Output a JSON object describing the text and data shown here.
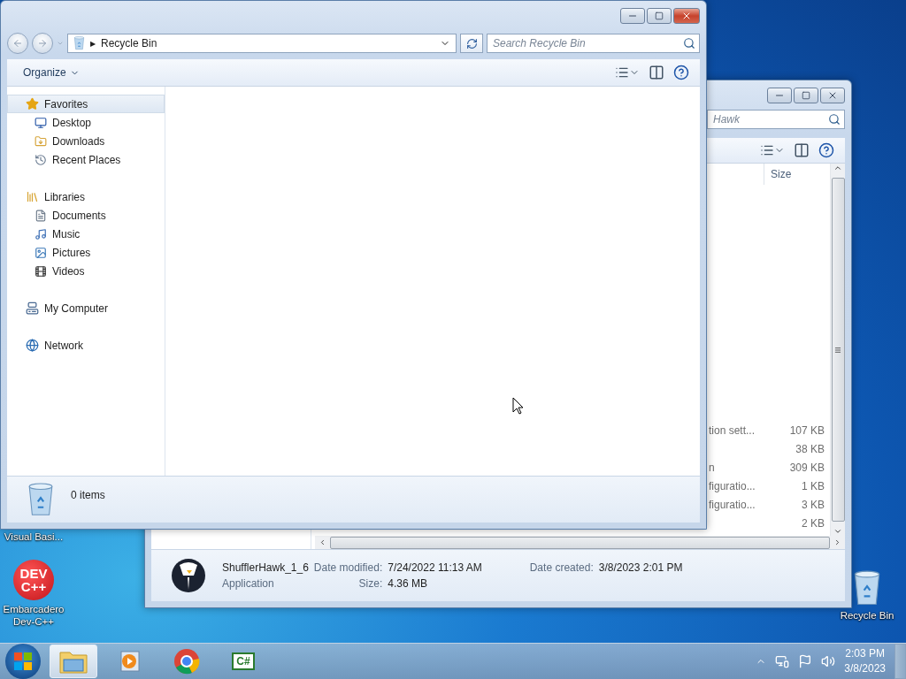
{
  "front_window": {
    "address": {
      "arrow": "▶",
      "location": "Recycle Bin"
    },
    "search": {
      "placeholder": "Search Recycle Bin"
    },
    "toolbar": {
      "organize": "Organize"
    },
    "sidebar": [
      {
        "label": "Favorites",
        "selected": true,
        "children": [
          {
            "label": "Desktop",
            "selected": false
          },
          {
            "label": "Downloads",
            "selected": false
          },
          {
            "label": "Recent Places",
            "selected": false
          }
        ]
      },
      {
        "label": "Libraries",
        "selected": false,
        "children": [
          {
            "label": "Documents",
            "selected": false
          },
          {
            "label": "Music",
            "selected": false
          },
          {
            "label": "Pictures",
            "selected": false
          },
          {
            "label": "Videos",
            "selected": false
          }
        ]
      },
      {
        "label": "My Computer",
        "selected": false
      },
      {
        "label": "Network",
        "selected": false
      }
    ],
    "status": {
      "count": "0 items"
    }
  },
  "back_window": {
    "search": {
      "placeholder": "Hawk"
    },
    "columns": [
      {
        "label": "Size"
      }
    ],
    "rows": [
      {
        "name": "tion sett...",
        "size": "107 KB"
      },
      {
        "name": "",
        "size": "38 KB"
      },
      {
        "name": "n",
        "size": "309 KB"
      },
      {
        "name": "figuratio...",
        "size": "1 KB"
      },
      {
        "name": "figuratio...",
        "size": "3 KB"
      },
      {
        "name": "",
        "size": "2 KB"
      }
    ],
    "details": {
      "name": "ShufflerHawk_1_6",
      "type": "Application",
      "modified_label": "Date modified:",
      "modified": "7/24/2022 11:13 AM",
      "created_label": "Date created:",
      "created": "3/8/2023 2:01 PM",
      "size_label": "Size:",
      "size": "4.36 MB"
    }
  },
  "desktop_icons": [
    {
      "label": "Visual Basi..."
    },
    {
      "label": "Embarcadero Dev-C++",
      "badge": "DEV\nC++"
    },
    {
      "label": "Recycle Bin"
    }
  ],
  "taskbar": {
    "buttons": [
      {
        "selected": true
      },
      {
        "selected": false
      },
      {
        "selected": false
      },
      {
        "selected": false,
        "label": "C#"
      }
    ],
    "clock": {
      "time": "2:03 PM",
      "date": "3/8/2023"
    }
  }
}
